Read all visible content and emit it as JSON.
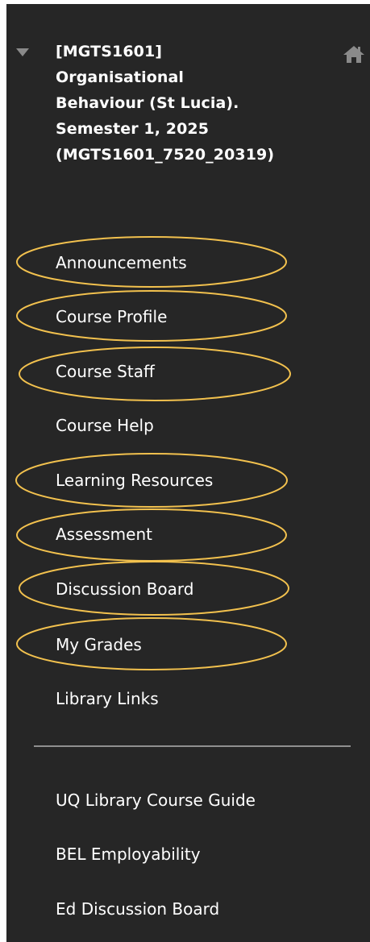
{
  "course": {
    "title_lines": [
      "[MGTS1601]",
      "Organisational",
      "Behaviour (St Lucia).",
      "Semester 1, 2025",
      "(MGTS1601_7520_20319)"
    ]
  },
  "menu": {
    "items": [
      {
        "label": "Announcements",
        "highlighted": true
      },
      {
        "label": "Course Profile",
        "highlighted": true
      },
      {
        "label": "Course Staff",
        "highlighted": true
      },
      {
        "label": "Course Help",
        "highlighted": false
      },
      {
        "label": "Learning Resources",
        "highlighted": true
      },
      {
        "label": "Assessment",
        "highlighted": true
      },
      {
        "label": "Discussion Board",
        "highlighted": true
      },
      {
        "label": "My Grades",
        "highlighted": true
      },
      {
        "label": "Library Links",
        "highlighted": false
      }
    ],
    "tools": [
      {
        "label": "UQ Library Course Guide"
      },
      {
        "label": "BEL Employability"
      },
      {
        "label": "Ed Discussion Board"
      }
    ]
  },
  "icons": {
    "collapse": "caret-down-icon",
    "home": "home-icon"
  },
  "colors": {
    "panel_background": "#262626",
    "text": "#ffffff",
    "highlight_outline": "#f2c14e",
    "icon": "#8a8a8a",
    "divider": "#8f8f8f"
  }
}
